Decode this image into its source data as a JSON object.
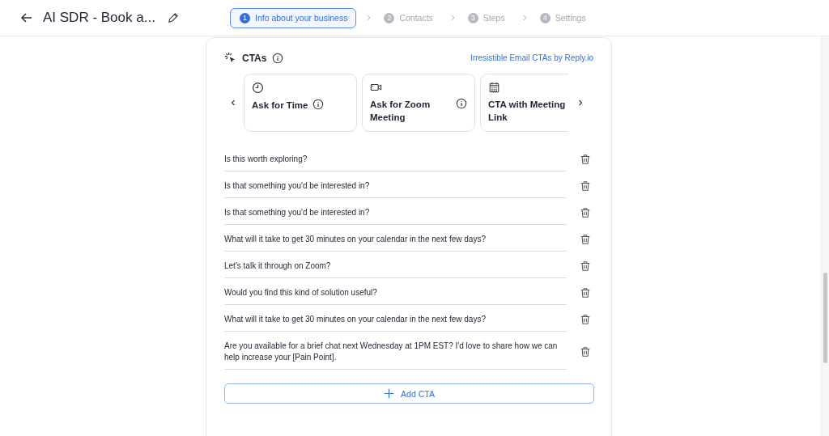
{
  "header": {
    "title": "AI SDR - Book a..."
  },
  "steps": [
    {
      "number": "1",
      "label": "Info about your business",
      "selected": true
    },
    {
      "number": "2",
      "label": "Contacts",
      "selected": false
    },
    {
      "number": "3",
      "label": "Steps",
      "selected": false
    },
    {
      "number": "4",
      "label": "Settings",
      "selected": false
    }
  ],
  "section": {
    "title": "CTAs",
    "link": "Irresistible Email CTAs by Reply.io"
  },
  "cta_types": [
    {
      "kind": "clock",
      "title": "Ask for Time",
      "info": true
    },
    {
      "kind": "video",
      "title": "Ask for Zoom Meeting",
      "info": true
    },
    {
      "kind": "calendar",
      "title": "CTA with Meeting Link"
    }
  ],
  "ctas": [
    "Is this worth exploring?",
    "Is that something you'd be interested in?",
    "Is that something you'd be interested in?",
    "What will it take to get 30 minutes on your calendar in the next few days?",
    "Let's talk it through on Zoom?",
    "Would you find this kind of solution useful?",
    "What will it take to get 30 minutes on your calendar in the next few days?",
    "Are you available for a brief chat next Wednesday at 1PM EST? I'd love to share how we can help increase your [Pain Point]."
  ],
  "add_button": "Add CTA"
}
